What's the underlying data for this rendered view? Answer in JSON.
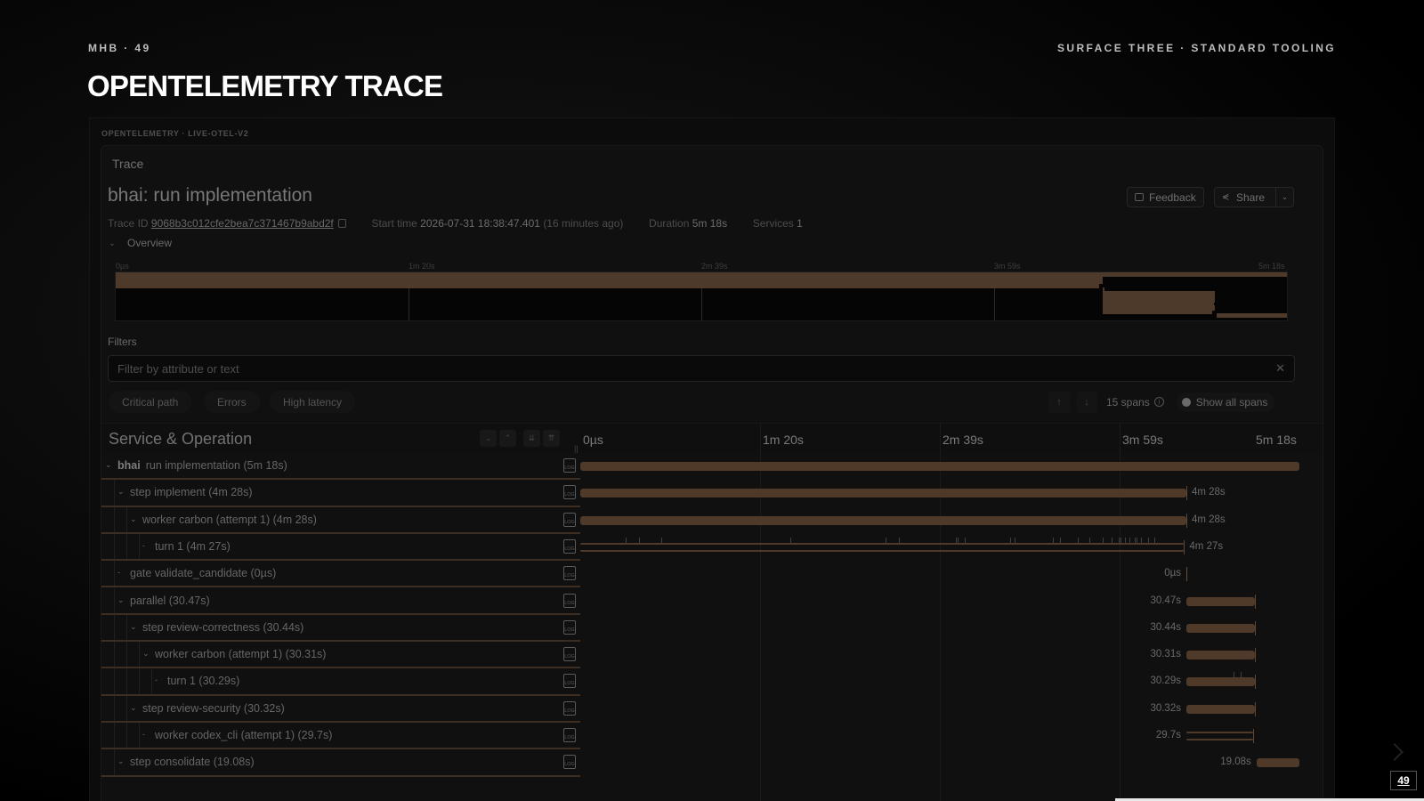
{
  "slide": {
    "top_left": "MHB · 49",
    "top_right": "SURFACE THREE · STANDARD TOOLING",
    "title": "OPENTELEMETRY TRACE",
    "page_number": "49"
  },
  "frame_caption": "OPENTELEMETRY · LIVE-OTEL-V2",
  "trace": {
    "panel_label": "Trace",
    "name": "bhai: run implementation",
    "trace_id_label": "Trace ID",
    "trace_id": "9068b3c012cfe2bea7c371467b9abd2f",
    "start_label": "Start time",
    "start_value": "2026-07-31 18:38:47.401",
    "start_ago": "(16 minutes ago)",
    "duration_label": "Duration",
    "duration_value": "5m 18s",
    "services_label": "Services",
    "services_value": "1"
  },
  "actions": {
    "feedback": "Feedback",
    "share": "Share"
  },
  "overview": {
    "label": "Overview",
    "ticks": [
      "0µs",
      "1m 20s",
      "2m 39s",
      "3m 59s",
      "5m 18s"
    ]
  },
  "filters": {
    "label": "Filters",
    "placeholder": "Filter by attribute or text",
    "chips": [
      "Critical path",
      "Errors",
      "High latency"
    ],
    "span_count": "15 spans",
    "show_all": "Show all spans"
  },
  "grid": {
    "title": "Service & Operation",
    "axis": [
      "0µs",
      "1m 20s",
      "2m 39s",
      "3m 59s",
      "5m 18s"
    ],
    "total_seconds": 318,
    "rows": [
      {
        "depth": 0,
        "service": "bhai",
        "label": "run implementation (5m 18s)",
        "start": 0,
        "dur": 318,
        "dur_label": ""
      },
      {
        "depth": 1,
        "label": "step implement (4m 28s)",
        "start": 0,
        "dur": 268,
        "dur_label": "4m 28s"
      },
      {
        "depth": 2,
        "label": "worker carbon (attempt 1) (4m 28s)",
        "start": 0,
        "dur": 268,
        "dur_label": "4m 28s"
      },
      {
        "depth": 3,
        "label": "turn 1 (4m 27s)",
        "start": 0,
        "dur": 267,
        "dur_label": "4m 27s",
        "thin": true,
        "events": [
          20,
          26,
          36,
          93,
          135,
          141,
          166,
          167,
          170,
          190,
          192,
          209,
          212,
          220,
          225,
          231,
          235,
          238,
          239,
          241,
          243,
          245,
          246,
          248,
          251,
          254
        ]
      },
      {
        "depth": 1,
        "label": "gate validate_candidate (0µs)",
        "start": 268,
        "dur": 0,
        "dur_label": "0µs"
      },
      {
        "depth": 1,
        "label": "parallel (30.47s)",
        "start": 268,
        "dur": 30.47,
        "dur_label": "30.47s"
      },
      {
        "depth": 2,
        "label": "step review-correctness (30.44s)",
        "start": 268,
        "dur": 30.44,
        "dur_label": "30.44s"
      },
      {
        "depth": 3,
        "label": "worker carbon (attempt 1) (30.31s)",
        "start": 268,
        "dur": 30.31,
        "dur_label": "30.31s"
      },
      {
        "depth": 4,
        "label": "turn 1 (30.29s)",
        "start": 268,
        "dur": 30.29,
        "dur_label": "30.29s",
        "events": [
          289,
          292
        ]
      },
      {
        "depth": 2,
        "label": "step review-security (30.32s)",
        "start": 268,
        "dur": 30.32,
        "dur_label": "30.32s"
      },
      {
        "depth": 3,
        "label": "worker codex_cli (attempt 1) (29.7s)",
        "start": 268,
        "dur": 29.7,
        "dur_label": "29.7s",
        "thin": true
      },
      {
        "depth": 1,
        "label": "step consolidate (19.08s)",
        "start": 299,
        "dur": 19.08,
        "dur_label": "19.08s"
      }
    ]
  },
  "colors": {
    "bar": "#4f3a29",
    "accent_line": "#3d2e23"
  }
}
